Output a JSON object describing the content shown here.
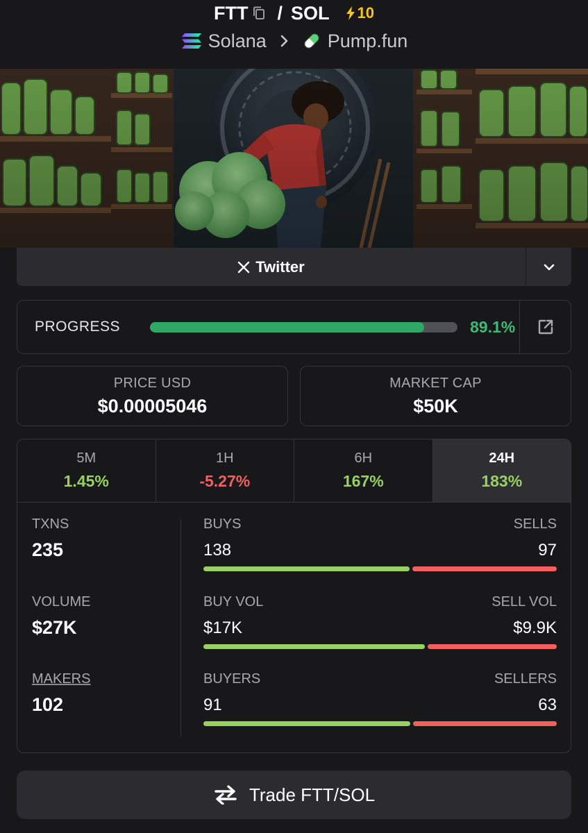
{
  "header": {
    "token_symbol": "FTT",
    "separator": "/",
    "quote_symbol": "SOL",
    "boost_count": "10"
  },
  "breadcrumb": {
    "chain": "Solana",
    "dex": "Pump.fun"
  },
  "socials": {
    "twitter_label": "Twitter"
  },
  "progress": {
    "label": "PROGRESS",
    "value_text": "89.1%",
    "fraction": 0.891
  },
  "price": {
    "label": "PRICE USD",
    "value": "$0.00005046"
  },
  "market_cap": {
    "label": "MARKET CAP",
    "value": "$50K"
  },
  "timeframes": [
    {
      "label": "5M",
      "change": "1.45%",
      "direction": "up",
      "active": false
    },
    {
      "label": "1H",
      "change": "-5.27%",
      "direction": "down",
      "active": false
    },
    {
      "label": "6H",
      "change": "167%",
      "direction": "up",
      "active": false
    },
    {
      "label": "24H",
      "change": "183%",
      "direction": "up",
      "active": true
    }
  ],
  "stats": {
    "txns": {
      "label": "TXNS",
      "value": "235"
    },
    "volume": {
      "label": "VOLUME",
      "value": "$27K"
    },
    "makers": {
      "label": "MAKERS",
      "value": "102"
    },
    "buys_sells": {
      "buy_label": "BUYS",
      "sell_label": "SELLS",
      "buy_value": "138",
      "sell_value": "97",
      "buy_amount": 138,
      "sell_amount": 97
    },
    "vol_split": {
      "buy_label": "BUY VOL",
      "sell_label": "SELL VOL",
      "buy_value": "$17K",
      "sell_value": "$9.9K",
      "buy_amount": 17,
      "sell_amount": 9.9
    },
    "traders": {
      "buy_label": "BUYERS",
      "sell_label": "SELLERS",
      "buy_value": "91",
      "sell_value": "63",
      "buy_amount": 91,
      "sell_amount": 63
    }
  },
  "trade_button": {
    "label": "Trade FTT/SOL"
  },
  "colors": {
    "background": "#18181b",
    "positive": "#97d162",
    "negative": "#f0605f",
    "progress": "#2fa866",
    "boost": "#f5c518"
  },
  "icons": {
    "copy": "copy-icon",
    "boost": "lightning-icon",
    "chain": "solana-icon",
    "dex": "pill-icon",
    "twitter": "x-icon",
    "toggle": "chevron-down-icon",
    "external": "external-link-icon",
    "trade": "swap-arrows-icon"
  }
}
